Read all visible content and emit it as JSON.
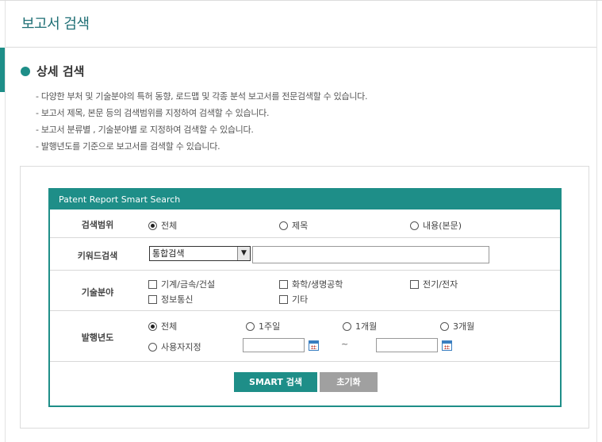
{
  "page": {
    "title": "보고서 검색",
    "section_title": "상세 검색",
    "descriptions": [
      "- 다양한 부처 및 기술분야의 특허 동향, 로드맵 및 각종 분석 보고서를 전문검색할 수 있습니다.",
      "- 보고서 제목, 본문 등의 검색범위를 지정하여 검색할 수 있습니다.",
      "- 보고서 분류별 , 기술분야별 로 지정하여 검색할 수 있습니다.",
      "- 발행년도를 기준으로 보고서를 검색할 수 있습니다."
    ]
  },
  "panel": {
    "header": "Patent Report Smart Search",
    "scope": {
      "label": "검색범위",
      "options": [
        "전체",
        "제목",
        "내용(본문)"
      ],
      "selected": "전체"
    },
    "keyword": {
      "label": "키워드검색",
      "select_value": "통합검색",
      "input_value": ""
    },
    "tech": {
      "label": "기술분야",
      "options": [
        "기계/금속/건설",
        "화학/생명공학",
        "전기/전자",
        "정보통신",
        "기타"
      ]
    },
    "year": {
      "label": "발행년도",
      "options": [
        "전체",
        "1주일",
        "1개월",
        "3개월",
        "사용자지정"
      ],
      "selected": "전체",
      "date_from": "",
      "date_to": "",
      "range_separator": "~"
    },
    "buttons": {
      "search": "SMART 검색",
      "reset": "초기화"
    }
  },
  "colors": {
    "accent": "#1e8e88",
    "title": "#1f6f75",
    "reset_button": "#a0a0a0"
  },
  "icons": [
    "calendar-icon",
    "chevron-down-icon"
  ]
}
